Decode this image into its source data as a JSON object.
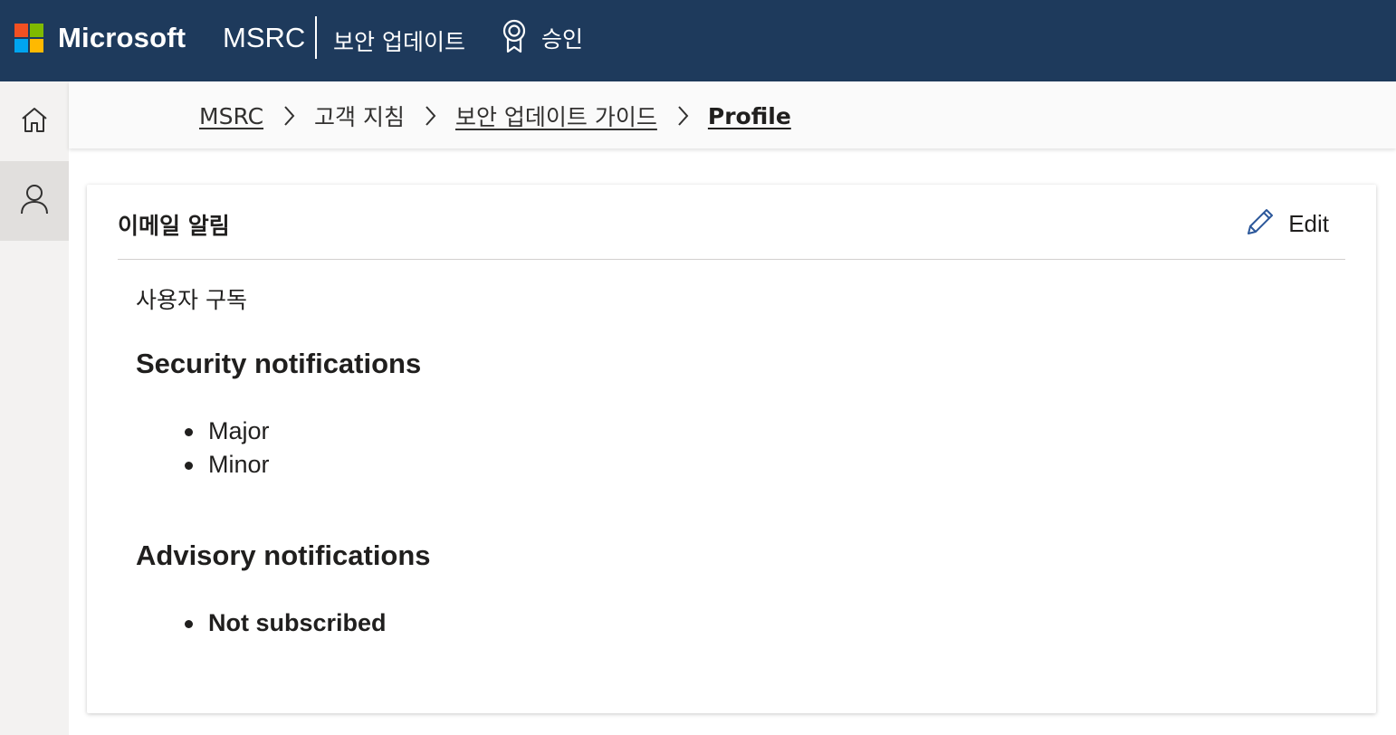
{
  "header": {
    "brand": "Microsoft",
    "site": "MSRC",
    "nav": [
      {
        "label": "보안 업데이트"
      },
      {
        "label": "승인",
        "icon": "ribbon-award-icon"
      }
    ],
    "logo_colors": [
      "#f25022",
      "#7fba00",
      "#00a4ef",
      "#ffb900"
    ],
    "background": "#1e3a5c"
  },
  "rail": {
    "items": [
      {
        "icon": "home-icon",
        "selected": false
      },
      {
        "icon": "person-icon",
        "selected": true
      }
    ]
  },
  "breadcrumb": {
    "items": [
      "MSRC",
      "고객 지침",
      "보안 업데이트 가이드",
      "Profile"
    ]
  },
  "card": {
    "title": "이메일 알림",
    "edit_label": "Edit",
    "subscriptions_label": "사용자 구독",
    "security": {
      "heading": "Security notifications",
      "items": [
        "Major",
        "Minor"
      ]
    },
    "advisory": {
      "heading": "Advisory notifications",
      "items": [
        "Not subscribed"
      ]
    }
  }
}
